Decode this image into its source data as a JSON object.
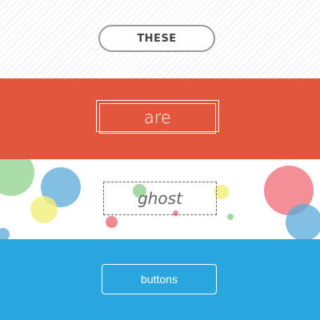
{
  "buttons": {
    "these_label": "THESE",
    "are_label": "are",
    "ghost_label": "ghost",
    "buttons_label": "buttons"
  },
  "colors": {
    "band_red": "#e2563e",
    "band_blue": "#2aa6df",
    "bubble_green": "#8fd18f",
    "bubble_blue": "#5aa9d8",
    "bubble_yellow": "#f3ee7a",
    "bubble_red": "#ef6b74"
  }
}
